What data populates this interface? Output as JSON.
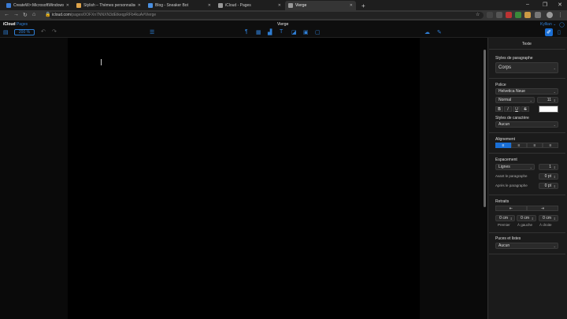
{
  "browser": {
    "tabs": [
      {
        "title": "CreateW>:MicrosoftWindowsDri",
        "favicon": "#3a7bd5"
      },
      {
        "title": "Stylish – Thèmes personnalisés",
        "favicon": "#e0a44a"
      },
      {
        "title": "Blog - Sneaker Bot",
        "favicon": "#4a90e2"
      },
      {
        "title": "iCloud - Pages",
        "favicon": "#999999"
      },
      {
        "title": "Vierge",
        "favicon": "#999999"
      }
    ],
    "new_tab_icon": "plus-icon",
    "url_domain": "icloud.com",
    "url_path": "/pages/0OFXn7NNXN3dEtkeqpRFb4kuA#Vierge",
    "window_controls": {
      "minimize": "–",
      "maximize": "❐",
      "close": "✕"
    }
  },
  "app": {
    "brand": "iCloud",
    "app_name": "Pages",
    "zoom": "200 %",
    "document_title": "Vierge",
    "user": "Kyllian",
    "accent": "#2f7fd6"
  },
  "inspector": {
    "header": "Texte",
    "paragraph_styles_label": "Styles de paragraphe",
    "paragraph_style": "Corps",
    "font_label": "Police",
    "font_family": "Helvetica Neue",
    "font_weight": "Normal",
    "font_size": "11",
    "bold": "B",
    "italic": "I",
    "underline": "U",
    "strike": "S",
    "text_color": "#ffffff",
    "char_styles_label": "Styles de caractère",
    "char_style": "Aucun",
    "alignment_label": "Alignement",
    "spacing_label": "Espacement",
    "spacing_mode": "Lignes",
    "spacing_value": "1",
    "before_label": "Avant le paragraphe",
    "before_value": "0 pt",
    "after_label": "Après le paragraphe",
    "after_value": "0 pt",
    "indents_label": "Retraits",
    "indent_first_value": "0 cm",
    "indent_left_value": "0 cm",
    "indent_right_value": "0 cm",
    "indent_first_label": "Premier",
    "indent_left_label": "À gauche",
    "indent_right_label": "À droite",
    "bullets_label": "Puces et listes",
    "bullets_value": "Aucun"
  }
}
